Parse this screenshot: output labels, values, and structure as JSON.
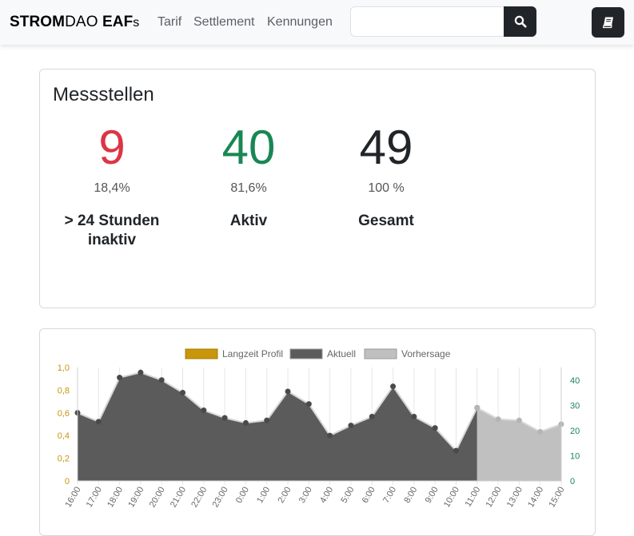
{
  "navbar": {
    "brand_strom": "STROM",
    "brand_dao": "DAO ",
    "brand_eaf": "EAF",
    "brand_s": "s",
    "links": [
      "Tarif",
      "Settlement",
      "Kennungen"
    ],
    "search": {
      "value": "",
      "icon": "search-icon"
    },
    "book_icon": "book-icon"
  },
  "messstellen": {
    "title": "Messstellen",
    "stats": [
      {
        "value": "9",
        "percent": "18,4%",
        "label_line1": "> 24 Stunden",
        "label_line2": "inaktiv",
        "color": "#dc3545"
      },
      {
        "value": "40",
        "percent": "81,6%",
        "label_line1": "Aktiv",
        "label_line2": "",
        "color": "#198754"
      },
      {
        "value": "49",
        "percent": "100 %",
        "label_line1": "Gesamt",
        "label_line2": "",
        "color": "#212529"
      }
    ]
  },
  "chart_data": {
    "type": "area",
    "legend": [
      {
        "name": "Langzeit Profil",
        "color": "#c8960a"
      },
      {
        "name": "Aktuell",
        "color": "#5b5b5b"
      },
      {
        "name": "Vorhersage",
        "color": "#c0c0c0"
      }
    ],
    "legend_position": "top",
    "categories": [
      "16:00",
      "17:00",
      "18:00",
      "19:00",
      "20:00",
      "21:00",
      "22:00",
      "23:00",
      "0:00",
      "1:00",
      "2:00",
      "3:00",
      "4:00",
      "5:00",
      "6:00",
      "7:00",
      "8:00",
      "9:00",
      "10:00",
      "11:00",
      "12:00",
      "13:00",
      "14:00",
      "15:00"
    ],
    "y_left": {
      "ticks": [
        "0",
        "0,2",
        "0,4",
        "0,6",
        "0,8",
        "1,0"
      ],
      "range": [
        0,
        1.0
      ],
      "color": "#c8960a"
    },
    "y_right": {
      "ticks": [
        "0",
        "10",
        "20",
        "30",
        "40"
      ],
      "range": [
        0,
        45
      ],
      "color": "#198754"
    },
    "series": [
      {
        "name": "Aktuell",
        "axis": "right",
        "color": "#5b5b5b",
        "x": [
          "16:00",
          "17:00",
          "18:00",
          "19:00",
          "20:00",
          "21:00",
          "22:00",
          "23:00",
          "0:00",
          "1:00",
          "2:00",
          "3:00",
          "4:00",
          "5:00",
          "6:00",
          "7:00",
          "8:00",
          "9:00",
          "10:00",
          "11:00"
        ],
        "values": [
          27,
          23.5,
          41,
          43,
          40,
          35,
          28,
          25,
          23,
          24,
          35.5,
          30.5,
          18,
          22,
          25.5,
          37.5,
          25.5,
          21,
          12,
          29
        ]
      },
      {
        "name": "Vorhersage",
        "axis": "right",
        "color": "#c0c0c0",
        "x": [
          "11:00",
          "12:00",
          "13:00",
          "14:00",
          "15:00"
        ],
        "values": [
          29,
          24.5,
          24,
          19.5,
          22.5
        ]
      }
    ],
    "grid": true
  }
}
